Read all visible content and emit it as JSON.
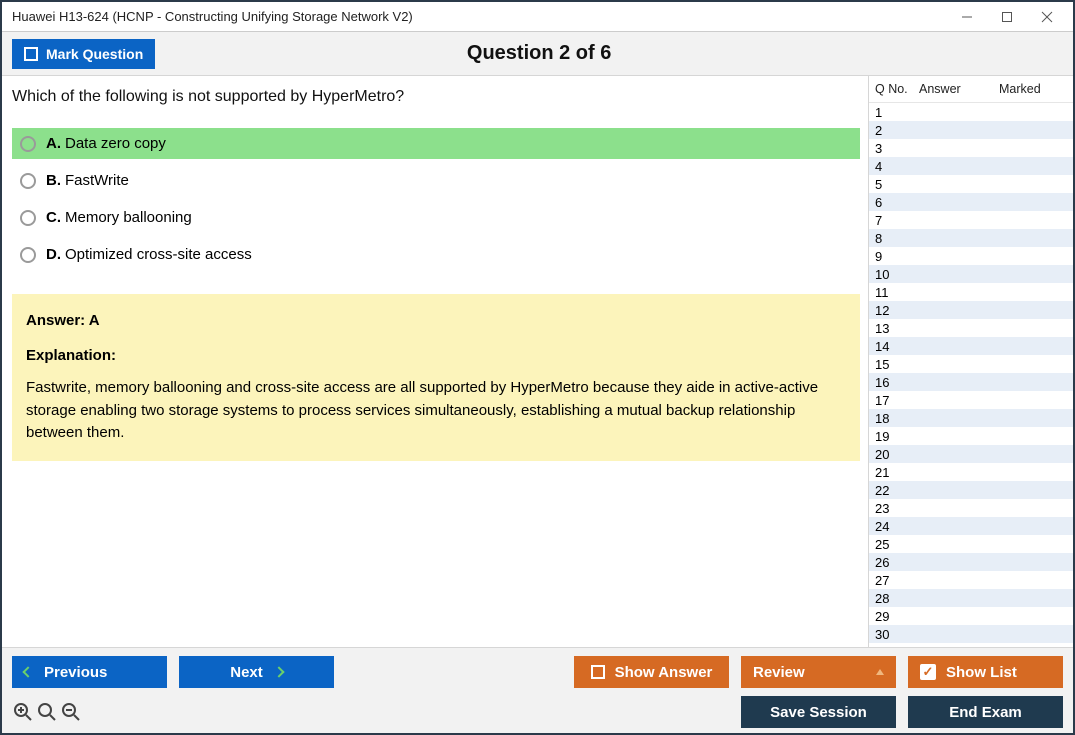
{
  "window_title": "Huawei H13-624 (HCNP - Constructing Unifying Storage Network V2)",
  "mark_label": "Mark Question",
  "question_header": "Question 2 of 6",
  "question_text": "Which of the following is not supported by HyperMetro?",
  "options": [
    {
      "letter": "A.",
      "text": "Data zero copy",
      "highlight": true
    },
    {
      "letter": "B.",
      "text": "FastWrite",
      "highlight": false
    },
    {
      "letter": "C.",
      "text": "Memory ballooning",
      "highlight": false
    },
    {
      "letter": "D.",
      "text": "Optimized cross-site access",
      "highlight": false
    }
  ],
  "answer_line": "Answer: A",
  "explanation_label": "Explanation:",
  "explanation_text": "Fastwrite, memory ballooning and cross-site access are all supported by HyperMetro because they aide in active-active storage enabling two storage systems to process services simultaneously, establishing a mutual backup relationship between them.",
  "side": {
    "col_q": "Q No.",
    "col_a": "Answer",
    "col_m": "Marked",
    "count": 30
  },
  "buttons": {
    "previous": "Previous",
    "next": "Next",
    "show_answer": "Show Answer",
    "review": "Review",
    "show_list": "Show List",
    "save_session": "Save Session",
    "end_exam": "End Exam"
  }
}
